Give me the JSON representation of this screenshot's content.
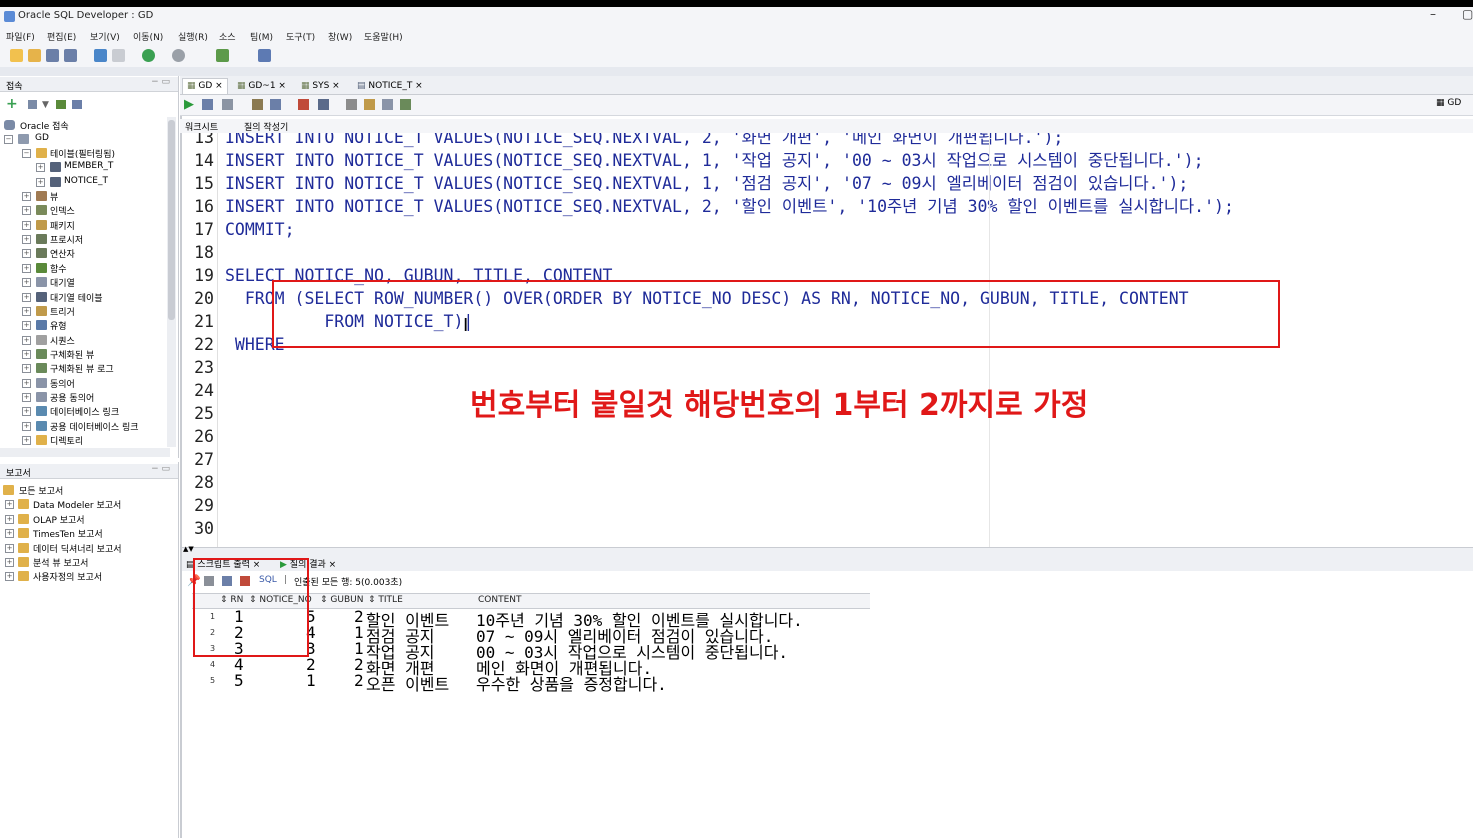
{
  "window": {
    "title": "Oracle SQL Developer : GD",
    "min": "–",
    "max": "▢"
  },
  "menu": [
    "파일(F)",
    "편집(E)",
    "보기(V)",
    "이동(N)",
    "실행(R)",
    "소스",
    "팀(M)",
    "도구(T)",
    "창(W)",
    "도움말(H)"
  ],
  "connections": {
    "panel_title": "접속",
    "root": "Oracle 접속",
    "conn": "GD",
    "items": [
      {
        "label": "테이블(필터링됨)",
        "level": 2,
        "exp": "−"
      },
      {
        "label": "MEMBER_T",
        "level": 3,
        "exp": "+"
      },
      {
        "label": "NOTICE_T",
        "level": 3,
        "exp": "+"
      },
      {
        "label": "뷰",
        "level": 2,
        "exp": "+"
      },
      {
        "label": "인덱스",
        "level": 2,
        "exp": "+"
      },
      {
        "label": "패키지",
        "level": 2,
        "exp": "+"
      },
      {
        "label": "프로시저",
        "level": 2,
        "exp": "+"
      },
      {
        "label": "연산자",
        "level": 2,
        "exp": "+"
      },
      {
        "label": "함수",
        "level": 2,
        "exp": "+"
      },
      {
        "label": "대기열",
        "level": 2,
        "exp": "+"
      },
      {
        "label": "대기열 테이블",
        "level": 2,
        "exp": "+"
      },
      {
        "label": "트리거",
        "level": 2,
        "exp": "+"
      },
      {
        "label": "유형",
        "level": 2,
        "exp": "+"
      },
      {
        "label": "시퀀스",
        "level": 2,
        "exp": "+"
      },
      {
        "label": "구체화된 뷰",
        "level": 2,
        "exp": "+"
      },
      {
        "label": "구체화된 뷰 로그",
        "level": 2,
        "exp": "+"
      },
      {
        "label": "동의어",
        "level": 2,
        "exp": "+"
      },
      {
        "label": "공용 동의어",
        "level": 2,
        "exp": "+"
      },
      {
        "label": "데이터베이스 링크",
        "level": 2,
        "exp": "+"
      },
      {
        "label": "공용 데이터베이스 링크",
        "level": 2,
        "exp": "+"
      },
      {
        "label": "디렉토리",
        "level": 2,
        "exp": "+"
      }
    ]
  },
  "reports": {
    "panel_title": "보고서",
    "items": [
      "모든 보고서",
      "Data Modeler 보고서",
      "OLAP 보고서",
      "TimesTen 보고서",
      "데이터 딕셔너리 보고서",
      "분석 뷰 보고서",
      "사용자정의 보고서"
    ]
  },
  "tabs": [
    "GD",
    "GD~1",
    "SYS",
    "NOTICE_T"
  ],
  "right_conn": "GD",
  "subtabs": [
    "워크시트",
    "질의 작성기"
  ],
  "code_lines": [
    {
      "n": "13",
      "t": "INSERT INTO NOTICE_T VALUES(NOTICE_SEQ.NEXTVAL, 2, '화면 개편', '메인 화면이 개편됩니다.');"
    },
    {
      "n": "14",
      "t": "INSERT INTO NOTICE_T VALUES(NOTICE_SEQ.NEXTVAL, 1, '작업 공지', '00 ~ 03시 작업으로 시스템이 중단됩니다.');"
    },
    {
      "n": "15",
      "t": "INSERT INTO NOTICE_T VALUES(NOTICE_SEQ.NEXTVAL, 1, '점검 공지', '07 ~ 09시 엘리베이터 점검이 있습니다.');"
    },
    {
      "n": "16",
      "t": "INSERT INTO NOTICE_T VALUES(NOTICE_SEQ.NEXTVAL, 2, '할인 이벤트', '10주년 기념 30% 할인 이벤트를 실시합니다.');"
    },
    {
      "n": "17",
      "t": "COMMIT;"
    },
    {
      "n": "18",
      "t": ""
    },
    {
      "n": "19",
      "t": "SELECT NOTICE_NO, GUBUN, TITLE, CONTENT"
    },
    {
      "n": "20",
      "t": "  FROM (SELECT ROW_NUMBER() OVER(ORDER BY NOTICE_NO DESC) AS RN, NOTICE_NO, GUBUN, TITLE, CONTENT"
    },
    {
      "n": "21",
      "t": "          FROM NOTICE_T)|"
    },
    {
      "n": "22",
      "t": " WHERE"
    },
    {
      "n": "23",
      "t": ""
    },
    {
      "n": "24",
      "t": ""
    },
    {
      "n": "25",
      "t": ""
    },
    {
      "n": "26",
      "t": ""
    },
    {
      "n": "27",
      "t": ""
    },
    {
      "n": "28",
      "t": ""
    },
    {
      "n": "29",
      "t": ""
    },
    {
      "n": "30",
      "t": ""
    }
  ],
  "annotation": "번호부터 붙일것 해당번호의 1부터 2까지로 가정",
  "result_tabs": [
    "스크립트 출력",
    "질의 결과"
  ],
  "result_status": "인출된 모든 행: 5(0.003초)",
  "sql_label": "SQL",
  "grid": {
    "headers": [
      "RN",
      "NOTICE_NO",
      "GUBUN",
      "TITLE",
      "CONTENT"
    ],
    "rows": [
      {
        "idx": "1",
        "rn": "1",
        "no": "5",
        "gubun": "2",
        "title": "할인 이벤트",
        "content": "10주년 기념 30% 할인 이벤트를 실시합니다."
      },
      {
        "idx": "2",
        "rn": "2",
        "no": "4",
        "gubun": "1",
        "title": "점검 공지",
        "content": "07 ~ 09시 엘리베이터 점검이 있습니다."
      },
      {
        "idx": "3",
        "rn": "3",
        "no": "3",
        "gubun": "1",
        "title": "작업 공지",
        "content": "00 ~ 03시 작업으로 시스템이 중단됩니다."
      },
      {
        "idx": "4",
        "rn": "4",
        "no": "2",
        "gubun": "2",
        "title": "화면 개편",
        "content": "메인 화면이 개편됩니다."
      },
      {
        "idx": "5",
        "rn": "5",
        "no": "1",
        "gubun": "2",
        "title": "오픈 이벤트",
        "content": "우수한 상품을 증정합니다."
      }
    ]
  },
  "colors": {
    "accent_red": "#e01818",
    "sql_blue": "#1f2b99"
  }
}
